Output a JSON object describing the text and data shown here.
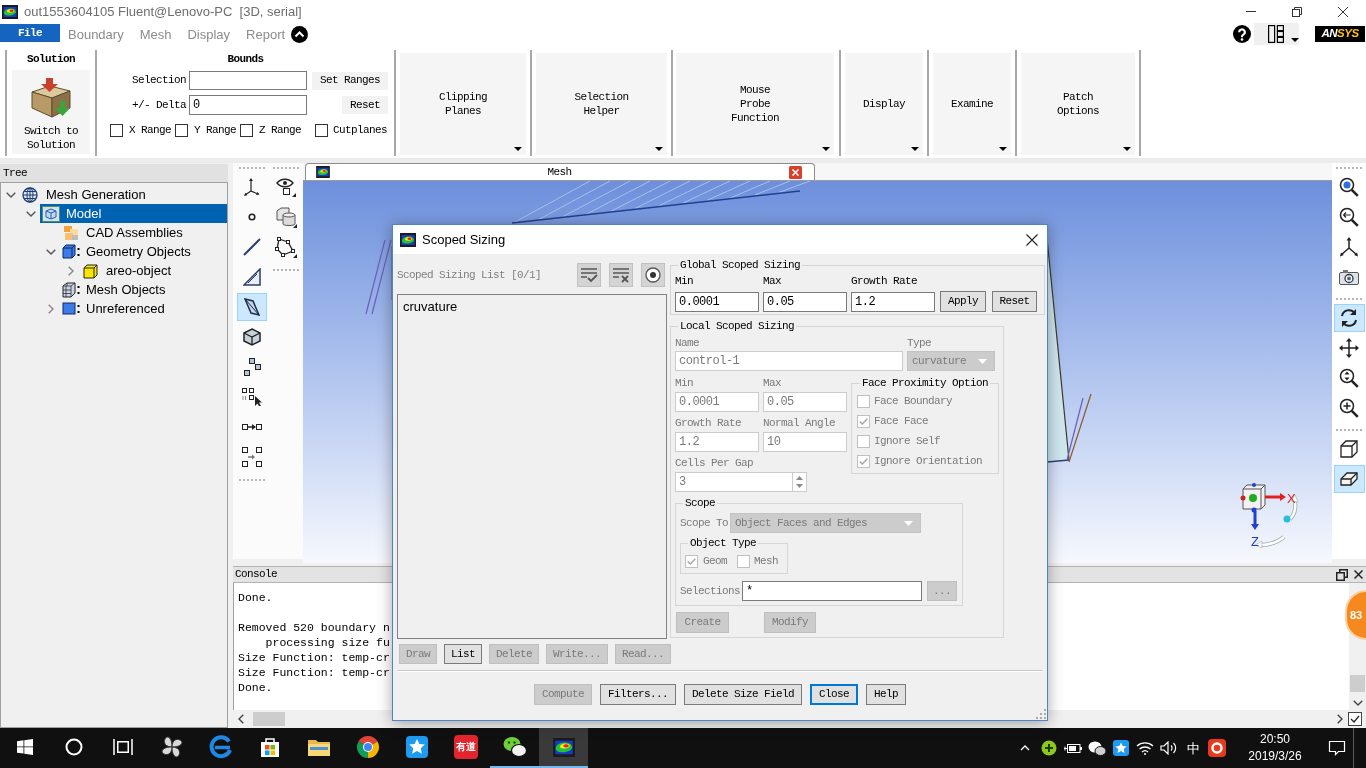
{
  "window": {
    "title": "out1553604105 Fluent@Lenovo-PC  [3D, serial]"
  },
  "menu": [
    {
      "label": "File",
      "kind": "file"
    },
    {
      "label": "Boundary",
      "kind": "tab"
    },
    {
      "label": "Mesh",
      "kind": "tab"
    },
    {
      "label": "Display",
      "kind": "tab"
    },
    {
      "label": "Report",
      "kind": "tab"
    }
  ],
  "logo": {
    "parts": [
      "AN",
      "SYS"
    ]
  },
  "ribbon": {
    "solution": {
      "title": "Solution",
      "button": "Switch to\nSolution"
    },
    "bounds": {
      "title": "Bounds",
      "fields": [
        {
          "label": "Selection",
          "button": "Set Ranges"
        },
        {
          "label": "+/- Delta",
          "value": "0",
          "button": "Reset"
        }
      ],
      "checks": [
        {
          "label": "X Range",
          "checked": false
        },
        {
          "label": "Y Range",
          "checked": false
        },
        {
          "label": "Z Range",
          "checked": false
        },
        {
          "label": "Cutplanes",
          "checked": false
        }
      ]
    },
    "tools": [
      {
        "label": "Clipping\nPlanes"
      },
      {
        "label": "Selection\nHelper"
      },
      {
        "label": "Mouse\nProbe\nFunction"
      },
      {
        "label": "Display"
      },
      {
        "label": "Examine"
      },
      {
        "label": "Patch\nOptions"
      }
    ]
  },
  "tree": {
    "title": "Tree",
    "items": [
      {
        "label": "Mesh Generation",
        "kind": "globe",
        "expanded": true,
        "selected": false,
        "children": [
          {
            "label": "Model",
            "kind": "model",
            "expanded": true,
            "selected": true,
            "children": [
              {
                "label": "CAD Assemblies",
                "kind": "cad",
                "selected": false
              },
              {
                "label": "Geometry Objects",
                "kind": "geometry",
                "expanded": true,
                "selected": false,
                "children": [
                  {
                    "label": "areo-object",
                    "kind": "object",
                    "expanded": false,
                    "selected": false
                  }
                ]
              },
              {
                "label": "Mesh Objects",
                "kind": "mesh",
                "selected": false
              },
              {
                "label": "Unreferenced",
                "kind": "unreferenced",
                "expanded": false,
                "selected": false
              }
            ]
          }
        ]
      }
    ]
  },
  "toolbars": {
    "left": [
      [
        {
          "kind": "axes",
          "selected": false
        },
        {
          "kind": "point",
          "selected": false
        },
        {
          "kind": "line",
          "selected": false
        },
        {
          "kind": "triangle",
          "selected": false
        },
        {
          "kind": "quad",
          "selected": true
        },
        {
          "kind": "polyhedron",
          "selected": false
        },
        {
          "kind": "cubes",
          "selected": false
        },
        {
          "kind": "select",
          "selected": false
        },
        {
          "kind": "connect",
          "selected": false
        },
        {
          "kind": "connect-grid",
          "selected": false
        }
      ],
      [
        {
          "kind": "eye",
          "selected": false
        },
        {
          "kind": "cylinder",
          "selected": false
        },
        {
          "kind": "polygon",
          "selected": false
        }
      ]
    ],
    "right": [
      [
        {
          "kind": "zoom-fit",
          "selected": false
        },
        {
          "kind": "zoom-back",
          "selected": false
        },
        {
          "kind": "views",
          "selected": false
        },
        {
          "kind": "camera",
          "selected": false
        }
      ],
      [
        {
          "kind": "rotate",
          "selected": true
        },
        {
          "kind": "pan",
          "selected": false
        },
        {
          "kind": "zoom",
          "selected": false
        },
        {
          "kind": "zoom-in",
          "selected": false
        }
      ],
      [
        {
          "kind": "box",
          "selected": false
        },
        {
          "kind": "box-shaded",
          "selected": true
        }
      ]
    ]
  },
  "graphics": {
    "tab": {
      "title": "Mesh"
    },
    "axis_labels": [
      "X",
      "Z"
    ]
  },
  "console": {
    "title": "Console",
    "blocks": [
      [
        "Done."
      ],
      [
        "Removed 520 boundary n",
        "    processing size fu",
        "Size Function: temp-cr",
        "Size Function: temp-cr",
        "Done."
      ]
    ]
  },
  "dialog": {
    "title": "Scoped Sizing",
    "list": {
      "label": "Scoped Sizing List [0/1]",
      "items": [
        {
          "label": "cruvature",
          "selected": false
        }
      ],
      "buttons": [
        {
          "label": "Draw",
          "disabled": true
        },
        {
          "label": "List",
          "disabled": false
        },
        {
          "label": "Delete",
          "disabled": true
        },
        {
          "label": "Write...",
          "disabled": true
        },
        {
          "label": "Read...",
          "disabled": true
        }
      ]
    },
    "global": {
      "title": "Global Scoped Sizing",
      "fields": [
        {
          "label": "Min",
          "value": "0.0001"
        },
        {
          "label": "Max",
          "value": "0.05"
        },
        {
          "label": "Growth Rate",
          "value": "1.2"
        }
      ],
      "buttons": [
        "Apply",
        "Reset"
      ]
    },
    "local": {
      "title": "Local Scoped Sizing",
      "disabled": true,
      "name": {
        "label": "Name",
        "value": "control-1"
      },
      "type": {
        "label": "Type",
        "value": "curvature"
      },
      "fields": [
        {
          "label": "Min",
          "value": "0.0001"
        },
        {
          "label": "Max",
          "value": "0.05"
        },
        {
          "label": "Growth Rate",
          "value": "1.2"
        },
        {
          "label": "Normal Angle",
          "value": "10"
        }
      ],
      "cells_per_gap": {
        "label": "Cells Per Gap",
        "value": "3"
      },
      "face_proximity": {
        "title": "Face Proximity Option",
        "options": [
          {
            "label": "Face Boundary",
            "checked": false
          },
          {
            "label": "Face Face",
            "checked": true
          },
          {
            "label": "Ignore Self",
            "checked": false
          },
          {
            "label": "Ignore Orientation",
            "checked": true
          }
        ]
      },
      "scope": {
        "title": "Scope",
        "scope_to": {
          "label": "Scope To",
          "value": "Object Faces and Edges"
        },
        "object_type": {
          "title": "Object Type",
          "options": [
            {
              "label": "Geom",
              "checked": true
            },
            {
              "label": "Mesh",
              "checked": false
            }
          ]
        },
        "selections": {
          "label": "Selections",
          "value": "*",
          "button": {
            "label": "...",
            "disabled": true
          }
        }
      },
      "buttons": [
        {
          "label": "Create",
          "disabled": true
        },
        {
          "label": "Modify",
          "disabled": true
        }
      ]
    },
    "footer": [
      {
        "label": "Compute",
        "disabled": true,
        "default": false
      },
      {
        "label": "Filters...",
        "disabled": false,
        "default": false
      },
      {
        "label": "Delete Size Field",
        "disabled": false,
        "default": false
      },
      {
        "label": "Close",
        "disabled": false,
        "default": true
      },
      {
        "label": "Help",
        "disabled": false,
        "default": false
      }
    ]
  },
  "taskbar": {
    "apps": [
      {
        "kind": "start",
        "selected": false,
        "running": false
      },
      {
        "kind": "search",
        "selected": false,
        "running": false
      },
      {
        "kind": "task-view",
        "selected": false,
        "running": false
      },
      {
        "kind": "pinwheel",
        "selected": false,
        "running": false
      },
      {
        "kind": "browser-e",
        "selected": false,
        "running": false
      },
      {
        "kind": "store",
        "selected": false,
        "running": false
      },
      {
        "kind": "folder",
        "selected": false,
        "running": false
      },
      {
        "kind": "browser-ball",
        "selected": false,
        "running": false
      },
      {
        "kind": "star",
        "selected": false,
        "running": false
      },
      {
        "kind": "text-tile",
        "label": "有道",
        "selected": false,
        "running": false
      },
      {
        "kind": "chat",
        "selected": false,
        "running": true
      },
      {
        "kind": "fluent",
        "selected": true,
        "running": true
      }
    ],
    "tray": {
      "ime": "中",
      "time": "20:50",
      "date": "2019/3/26"
    }
  },
  "floating_ball": {
    "text": "83"
  }
}
